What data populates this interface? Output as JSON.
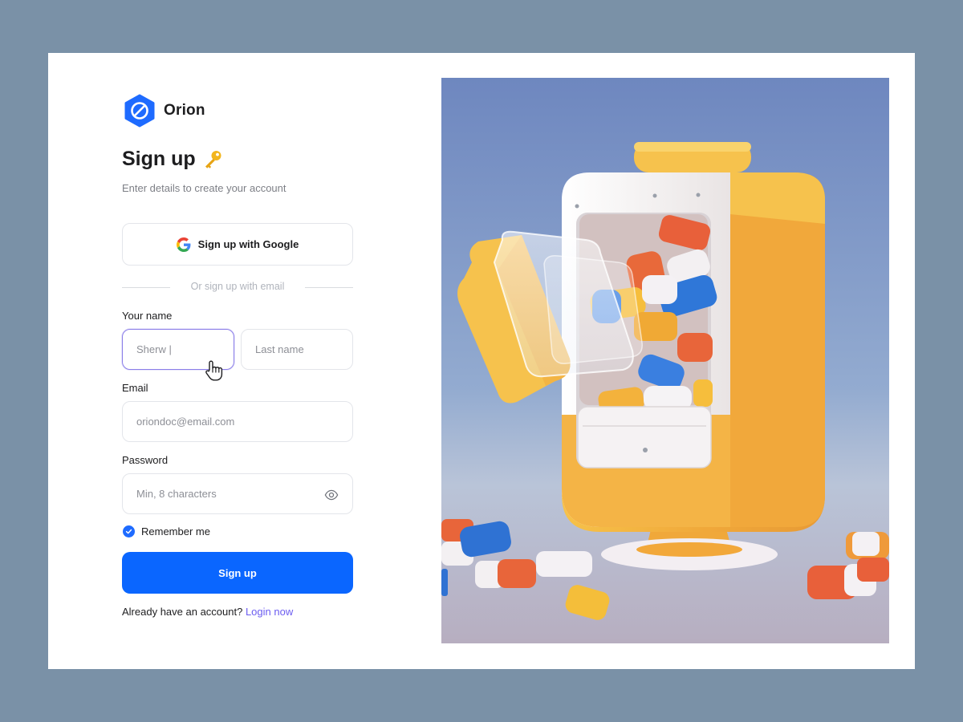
{
  "brand": {
    "name": "Orion",
    "color": "#1e6bff"
  },
  "header": {
    "title": "Sign up",
    "title_icon": "key-icon",
    "subtitle": "Enter details to create your account"
  },
  "google": {
    "label": "Sign up with Google",
    "icon": "google-icon"
  },
  "divider": {
    "text": "Or sign up with email"
  },
  "form": {
    "name_label": "Your name",
    "first_name_value": "Sherw |",
    "last_name_placeholder": "Last name",
    "email_label": "Email",
    "email_placeholder": "oriondoc@email.com",
    "password_label": "Password",
    "password_placeholder": "Min, 8 characters",
    "remember_label": "Remember me",
    "remember_checked": true,
    "submit_label": "Sign up"
  },
  "footer": {
    "prompt": "Already have an account?",
    "link": "Login now"
  },
  "colors": {
    "background": "#7a91a7",
    "primary": "#0a66ff",
    "link": "#6b5cf0",
    "active_border": "#8b7ee8"
  }
}
